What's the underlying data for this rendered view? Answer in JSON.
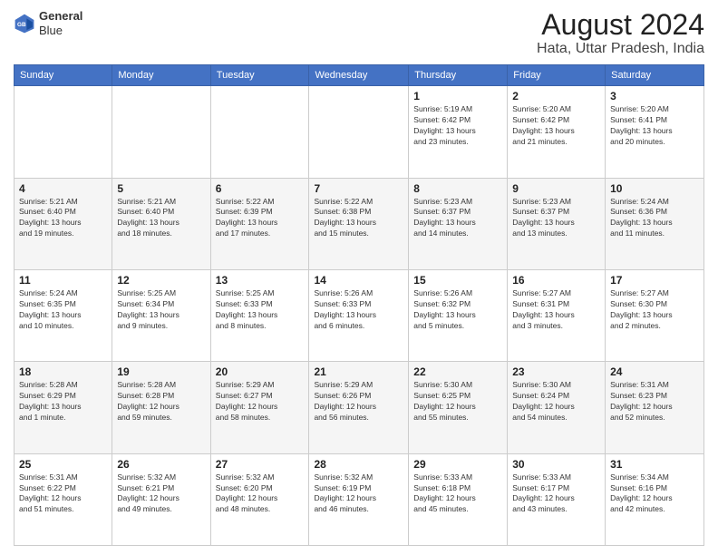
{
  "header": {
    "logo_line1": "General",
    "logo_line2": "Blue",
    "title": "August 2024",
    "subtitle": "Hata, Uttar Pradesh, India"
  },
  "days_of_week": [
    "Sunday",
    "Monday",
    "Tuesday",
    "Wednesday",
    "Thursday",
    "Friday",
    "Saturday"
  ],
  "weeks": [
    [
      {
        "day": "",
        "info": ""
      },
      {
        "day": "",
        "info": ""
      },
      {
        "day": "",
        "info": ""
      },
      {
        "day": "",
        "info": ""
      },
      {
        "day": "1",
        "info": "Sunrise: 5:19 AM\nSunset: 6:42 PM\nDaylight: 13 hours\nand 23 minutes."
      },
      {
        "day": "2",
        "info": "Sunrise: 5:20 AM\nSunset: 6:42 PM\nDaylight: 13 hours\nand 21 minutes."
      },
      {
        "day": "3",
        "info": "Sunrise: 5:20 AM\nSunset: 6:41 PM\nDaylight: 13 hours\nand 20 minutes."
      }
    ],
    [
      {
        "day": "4",
        "info": "Sunrise: 5:21 AM\nSunset: 6:40 PM\nDaylight: 13 hours\nand 19 minutes."
      },
      {
        "day": "5",
        "info": "Sunrise: 5:21 AM\nSunset: 6:40 PM\nDaylight: 13 hours\nand 18 minutes."
      },
      {
        "day": "6",
        "info": "Sunrise: 5:22 AM\nSunset: 6:39 PM\nDaylight: 13 hours\nand 17 minutes."
      },
      {
        "day": "7",
        "info": "Sunrise: 5:22 AM\nSunset: 6:38 PM\nDaylight: 13 hours\nand 15 minutes."
      },
      {
        "day": "8",
        "info": "Sunrise: 5:23 AM\nSunset: 6:37 PM\nDaylight: 13 hours\nand 14 minutes."
      },
      {
        "day": "9",
        "info": "Sunrise: 5:23 AM\nSunset: 6:37 PM\nDaylight: 13 hours\nand 13 minutes."
      },
      {
        "day": "10",
        "info": "Sunrise: 5:24 AM\nSunset: 6:36 PM\nDaylight: 13 hours\nand 11 minutes."
      }
    ],
    [
      {
        "day": "11",
        "info": "Sunrise: 5:24 AM\nSunset: 6:35 PM\nDaylight: 13 hours\nand 10 minutes."
      },
      {
        "day": "12",
        "info": "Sunrise: 5:25 AM\nSunset: 6:34 PM\nDaylight: 13 hours\nand 9 minutes."
      },
      {
        "day": "13",
        "info": "Sunrise: 5:25 AM\nSunset: 6:33 PM\nDaylight: 13 hours\nand 8 minutes."
      },
      {
        "day": "14",
        "info": "Sunrise: 5:26 AM\nSunset: 6:33 PM\nDaylight: 13 hours\nand 6 minutes."
      },
      {
        "day": "15",
        "info": "Sunrise: 5:26 AM\nSunset: 6:32 PM\nDaylight: 13 hours\nand 5 minutes."
      },
      {
        "day": "16",
        "info": "Sunrise: 5:27 AM\nSunset: 6:31 PM\nDaylight: 13 hours\nand 3 minutes."
      },
      {
        "day": "17",
        "info": "Sunrise: 5:27 AM\nSunset: 6:30 PM\nDaylight: 13 hours\nand 2 minutes."
      }
    ],
    [
      {
        "day": "18",
        "info": "Sunrise: 5:28 AM\nSunset: 6:29 PM\nDaylight: 13 hours\nand 1 minute."
      },
      {
        "day": "19",
        "info": "Sunrise: 5:28 AM\nSunset: 6:28 PM\nDaylight: 12 hours\nand 59 minutes."
      },
      {
        "day": "20",
        "info": "Sunrise: 5:29 AM\nSunset: 6:27 PM\nDaylight: 12 hours\nand 58 minutes."
      },
      {
        "day": "21",
        "info": "Sunrise: 5:29 AM\nSunset: 6:26 PM\nDaylight: 12 hours\nand 56 minutes."
      },
      {
        "day": "22",
        "info": "Sunrise: 5:30 AM\nSunset: 6:25 PM\nDaylight: 12 hours\nand 55 minutes."
      },
      {
        "day": "23",
        "info": "Sunrise: 5:30 AM\nSunset: 6:24 PM\nDaylight: 12 hours\nand 54 minutes."
      },
      {
        "day": "24",
        "info": "Sunrise: 5:31 AM\nSunset: 6:23 PM\nDaylight: 12 hours\nand 52 minutes."
      }
    ],
    [
      {
        "day": "25",
        "info": "Sunrise: 5:31 AM\nSunset: 6:22 PM\nDaylight: 12 hours\nand 51 minutes."
      },
      {
        "day": "26",
        "info": "Sunrise: 5:32 AM\nSunset: 6:21 PM\nDaylight: 12 hours\nand 49 minutes."
      },
      {
        "day": "27",
        "info": "Sunrise: 5:32 AM\nSunset: 6:20 PM\nDaylight: 12 hours\nand 48 minutes."
      },
      {
        "day": "28",
        "info": "Sunrise: 5:32 AM\nSunset: 6:19 PM\nDaylight: 12 hours\nand 46 minutes."
      },
      {
        "day": "29",
        "info": "Sunrise: 5:33 AM\nSunset: 6:18 PM\nDaylight: 12 hours\nand 45 minutes."
      },
      {
        "day": "30",
        "info": "Sunrise: 5:33 AM\nSunset: 6:17 PM\nDaylight: 12 hours\nand 43 minutes."
      },
      {
        "day": "31",
        "info": "Sunrise: 5:34 AM\nSunset: 6:16 PM\nDaylight: 12 hours\nand 42 minutes."
      }
    ]
  ]
}
